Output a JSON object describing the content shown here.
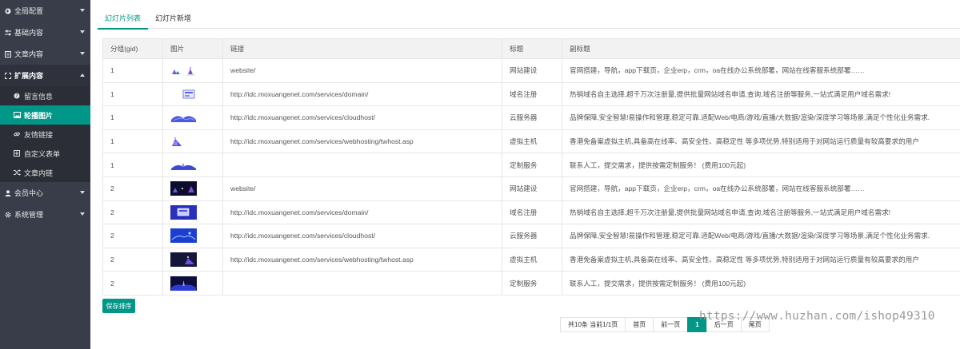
{
  "sidebar": {
    "items": [
      {
        "label": "全局配置",
        "icon": "globe-icon"
      },
      {
        "label": "基础内容",
        "icon": "sliders-icon"
      },
      {
        "label": "文章内容",
        "icon": "article-icon"
      },
      {
        "label": "扩展内容",
        "icon": "expand-icon",
        "expanded": true,
        "children": [
          {
            "label": "留言信息",
            "icon": "question-icon"
          },
          {
            "label": "轮播图片",
            "icon": "image-icon",
            "active": true
          },
          {
            "label": "友情链接",
            "icon": "link-icon"
          },
          {
            "label": "自定义表单",
            "icon": "form-icon"
          },
          {
            "label": "文章内链",
            "icon": "shuffle-icon"
          }
        ]
      },
      {
        "label": "会员中心",
        "icon": "user-icon"
      },
      {
        "label": "系统管理",
        "icon": "gear-icon"
      }
    ]
  },
  "tabs": [
    {
      "label": "幻灯片列表",
      "active": true
    },
    {
      "label": "幻灯片新增",
      "active": false
    }
  ],
  "table": {
    "headers": [
      "分组(gid)",
      "图片",
      "链接",
      "标题",
      "副标题"
    ],
    "rows": [
      {
        "gid": "1",
        "link": "website/",
        "title": "网站建设",
        "subtitle": "官网搭建，导航，app下载页，企业erp，crm，oa在线办公系统部署，网站在线客服系统部署……",
        "thumb": "light-a"
      },
      {
        "gid": "1",
        "link": "http://idc.moxuangenet.com/services/domain/",
        "title": "域名注册",
        "subtitle": "热销域名自主选择,超千万次注册量,提供批量网站域名申请,查询,域名注册等服务,一站式满足用户域名需求!",
        "thumb": "light-b"
      },
      {
        "gid": "1",
        "link": "http://idc.moxuangenet.com/services/cloudhost/",
        "title": "云服务器",
        "subtitle": "品牌保障,安全智慧!易操作和管理,稳定可靠.适配Web/电商/游戏/直播/大数据/渲染/深度学习等场景,满足个性化业务需求.",
        "thumb": "light-c"
      },
      {
        "gid": "1",
        "link": "http://idc.moxuangenet.com/services/webhosting/twhost.asp",
        "title": "虚拟主机",
        "subtitle": "香港免备案虚拟主机,具备高在线率、高安全性、高稳定性 等多项优势,特别适用于对网站运行质量有较高要求的用户",
        "thumb": "light-d"
      },
      {
        "gid": "1",
        "link": "",
        "title": "定制服务",
        "subtitle": "联系人工，提交需求，提供按需定制服务！ (费用100元起)",
        "thumb": "light-e"
      },
      {
        "gid": "2",
        "link": "website/",
        "title": "网站建设",
        "subtitle": "官网搭建，导航，app下载页，企业erp，crm，oa在线办公系统部署，网站在线客服系统部署……",
        "thumb": "dark-a"
      },
      {
        "gid": "2",
        "link": "http://idc.moxuangenet.com/services/domain/",
        "title": "域名注册",
        "subtitle": "热销域名自主选择,超千万次注册量,提供批量网站域名申请,查询,域名注册等服务,一站式满足用户域名需求!",
        "thumb": "dark-b"
      },
      {
        "gid": "2",
        "link": "http://idc.moxuangenet.com/services/cloudhost/",
        "title": "云服务器",
        "subtitle": "品牌保障,安全智慧!易操作和管理,稳定可靠.适配Web/电商/游戏/直播/大数据/渲染/深度学习等场景,满足个性化业务需求.",
        "thumb": "dark-c"
      },
      {
        "gid": "2",
        "link": "http://idc.moxuangenet.com/services/webhosting/twhost.asp",
        "title": "虚拟主机",
        "subtitle": "香港免备案虚拟主机,具备高在线率、高安全性、高稳定性 等多项优势,特别适用于对网站运行质量有较高要求的用户",
        "thumb": "dark-d"
      },
      {
        "gid": "2",
        "link": "",
        "title": "定制服务",
        "subtitle": "联系人工，提交需求，提供按需定制服务！ (费用100元起)",
        "thumb": "dark-e"
      }
    ]
  },
  "save_button": "保存排序",
  "pagination": {
    "info": "共10条 当前1/1页",
    "first": "首页",
    "prev": "前一页",
    "current": "1",
    "next": "后一页",
    "last": "尾页"
  },
  "watermark": "https://www.huzhan.com/ishop49310",
  "colors": {
    "accent": "#009688",
    "sidebar": "#393d49"
  }
}
